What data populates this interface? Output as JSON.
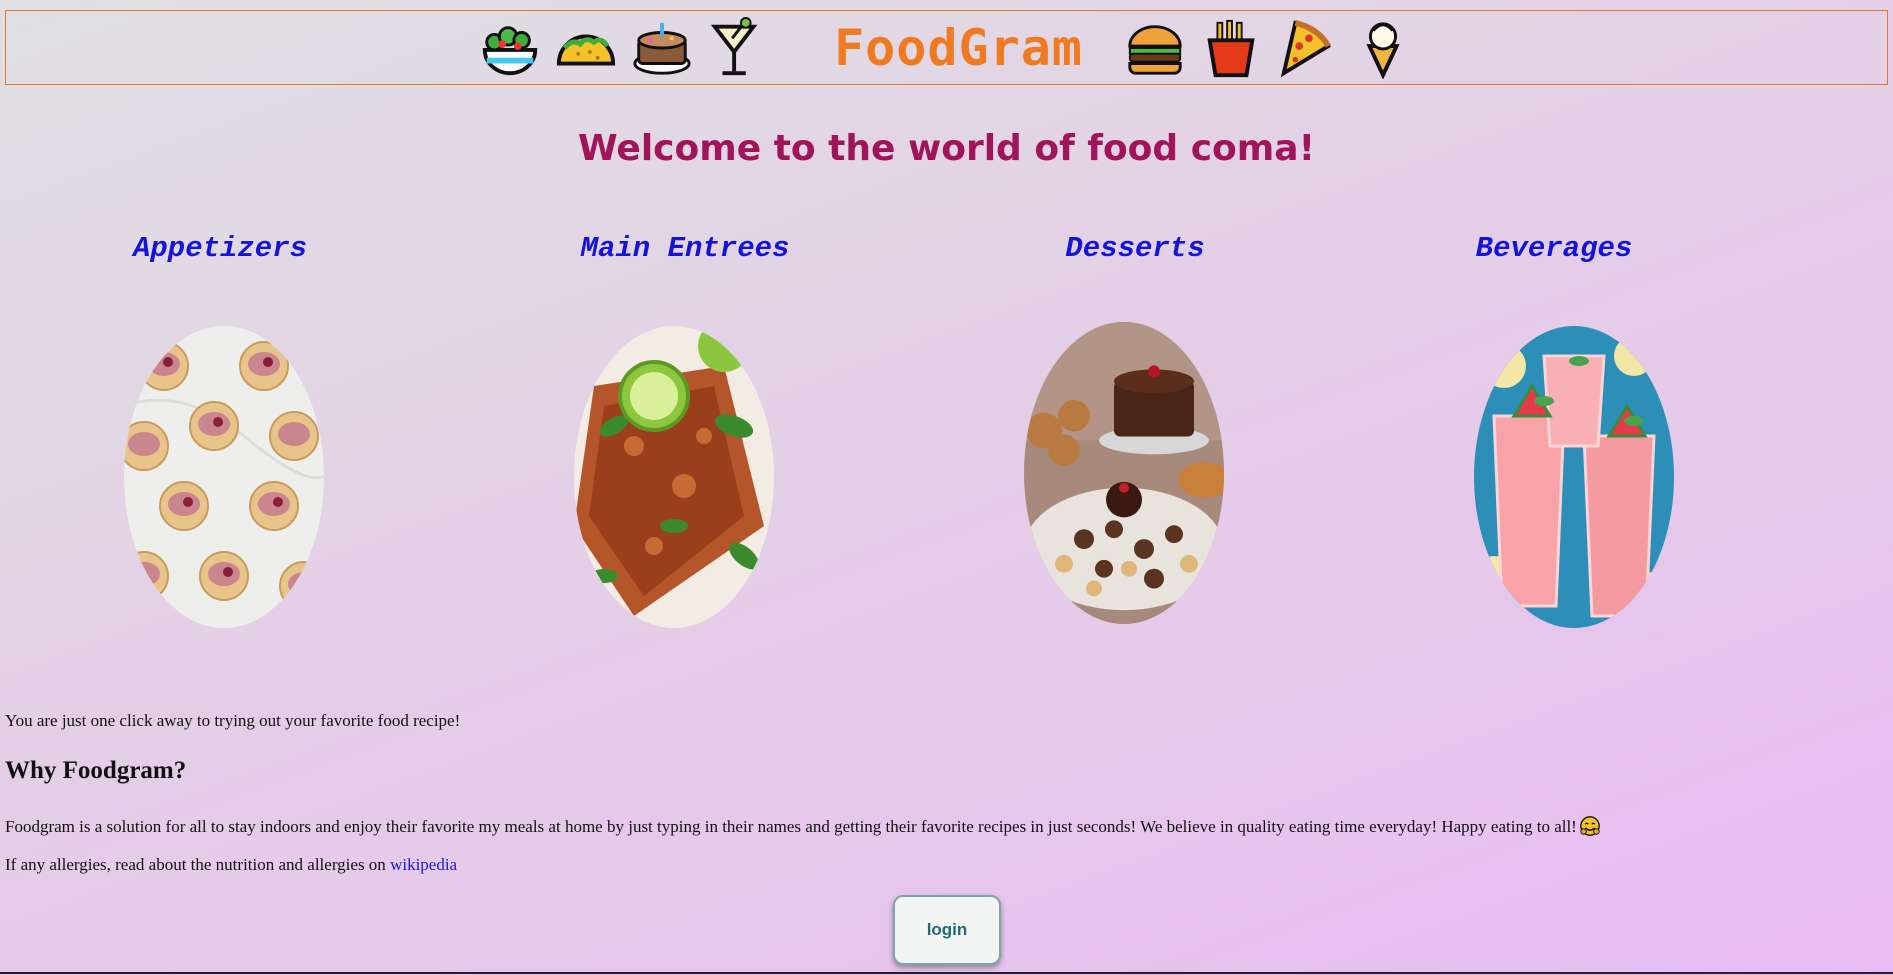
{
  "header": {
    "title": "FoodGram",
    "left_icons": [
      "salad-icon",
      "taco-icon",
      "cake-icon",
      "cocktail-icon"
    ],
    "right_icons": [
      "burger-icon",
      "fries-icon",
      "pizza-icon",
      "ice-cream-icon"
    ],
    "title_color": "#f07a22",
    "border_color": "#e07a30"
  },
  "welcome": "Welcome to the world of food coma!",
  "categories": [
    {
      "label": "Appetizers"
    },
    {
      "label": "Main Entrees"
    },
    {
      "label": "Desserts"
    },
    {
      "label": "Beverages"
    }
  ],
  "tagline": "You are just one click away to trying out your favorite food recipe!",
  "why_heading": "Why Foodgram?",
  "description": "Foodgram is a solution for all to stay indoors and enjoy their favorite my meals at home by just typing in their names and getting their favorite recipes in just seconds! We believe in quality eating time everyday! Happy eating to all!",
  "allergy": {
    "prefix": "If any allergies, read about the nutrition and allergies on ",
    "link_text": "wikipedia"
  },
  "login_label": "login",
  "colors": {
    "welcome": "#a0145a",
    "category": "#1414d8",
    "link": "#1a1ad4"
  }
}
